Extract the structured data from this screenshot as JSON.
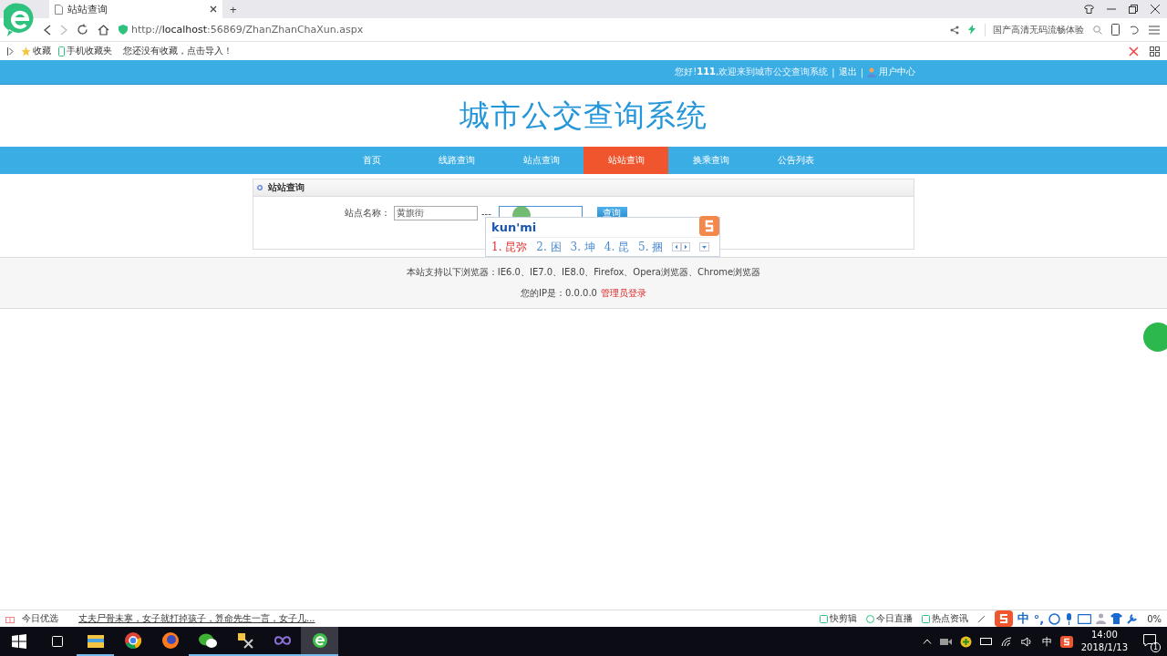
{
  "browser": {
    "tab_title": "站站查询",
    "new_tab": "+",
    "url": "http://**localhost**:56869/ZhanZhanChaXun.aspx",
    "search_hint": "国产高清无码流畅体验",
    "bookmarks": [
      {
        "label": "收藏",
        "kind": "fav"
      },
      {
        "label": "手机收藏夹",
        "kind": "phone"
      },
      {
        "label": "您还没有收藏，点击导入！",
        "kind": "text"
      }
    ]
  },
  "topbar": {
    "greeting": "您好!**111**,欢迎来到城市公交查询系统",
    "separators": [
      "|",
      "|"
    ],
    "logout": "退出",
    "user_center": "用户中心"
  },
  "site_title": "城市公交查询系统",
  "nav": [
    {
      "label": "首页",
      "selected": false
    },
    {
      "label": "线路查询",
      "selected": false
    },
    {
      "label": "站点查询",
      "selected": false
    },
    {
      "label": "站站查询",
      "selected": true
    },
    {
      "label": "换乘查询",
      "selected": false
    },
    {
      "label": "公告列表",
      "selected": false
    }
  ],
  "panel": {
    "title": "站站查询",
    "field_label": "站点名称：",
    "from_value": "黄旗街",
    "dash": "---",
    "button": "查询"
  },
  "ime": {
    "composition": "kun'mi",
    "candidates": [
      {
        "label": "1. 昆弥",
        "selected": true
      },
      {
        "label": "2. 困",
        "selected": false
      },
      {
        "label": "3. 坤",
        "selected": false
      },
      {
        "label": "4. 昆",
        "selected": false
      },
      {
        "label": "5. 捆",
        "selected": false
      }
    ]
  },
  "footer": {
    "browsers": "本站支持以下浏览器：IE6.0、IE7.0、IE8.0、Firefox、Opera浏览器、Chrome浏览器",
    "ip": "您的IP是：0.0.0.0",
    "admin_link": "管理员登录"
  },
  "status_bar": {
    "left": "今日优选",
    "news": "丈夫尸骨未寒，女子就打掉孩子，算命先生一言，女子几...",
    "tools": [
      "快剪辑",
      "今日直播",
      "热点资讯"
    ],
    "ime_mode": "中",
    "ime_punct": "°,",
    "zoom": "0%"
  },
  "taskbar": {
    "apps": [
      {
        "kind": "files",
        "selected": false,
        "running": true
      },
      {
        "kind": "chrome",
        "selected": false,
        "running": false
      },
      {
        "kind": "firefox",
        "selected": false,
        "running": false
      },
      {
        "kind": "wechat",
        "selected": false,
        "running": true
      },
      {
        "kind": "tools",
        "selected": false,
        "running": true
      },
      {
        "kind": "vs",
        "selected": false,
        "running": true
      },
      {
        "kind": "ebrowser",
        "selected": true,
        "running": true
      }
    ],
    "tray_ime": "中",
    "time": "14:00",
    "date": "2018/1/13",
    "notifications": "1"
  }
}
